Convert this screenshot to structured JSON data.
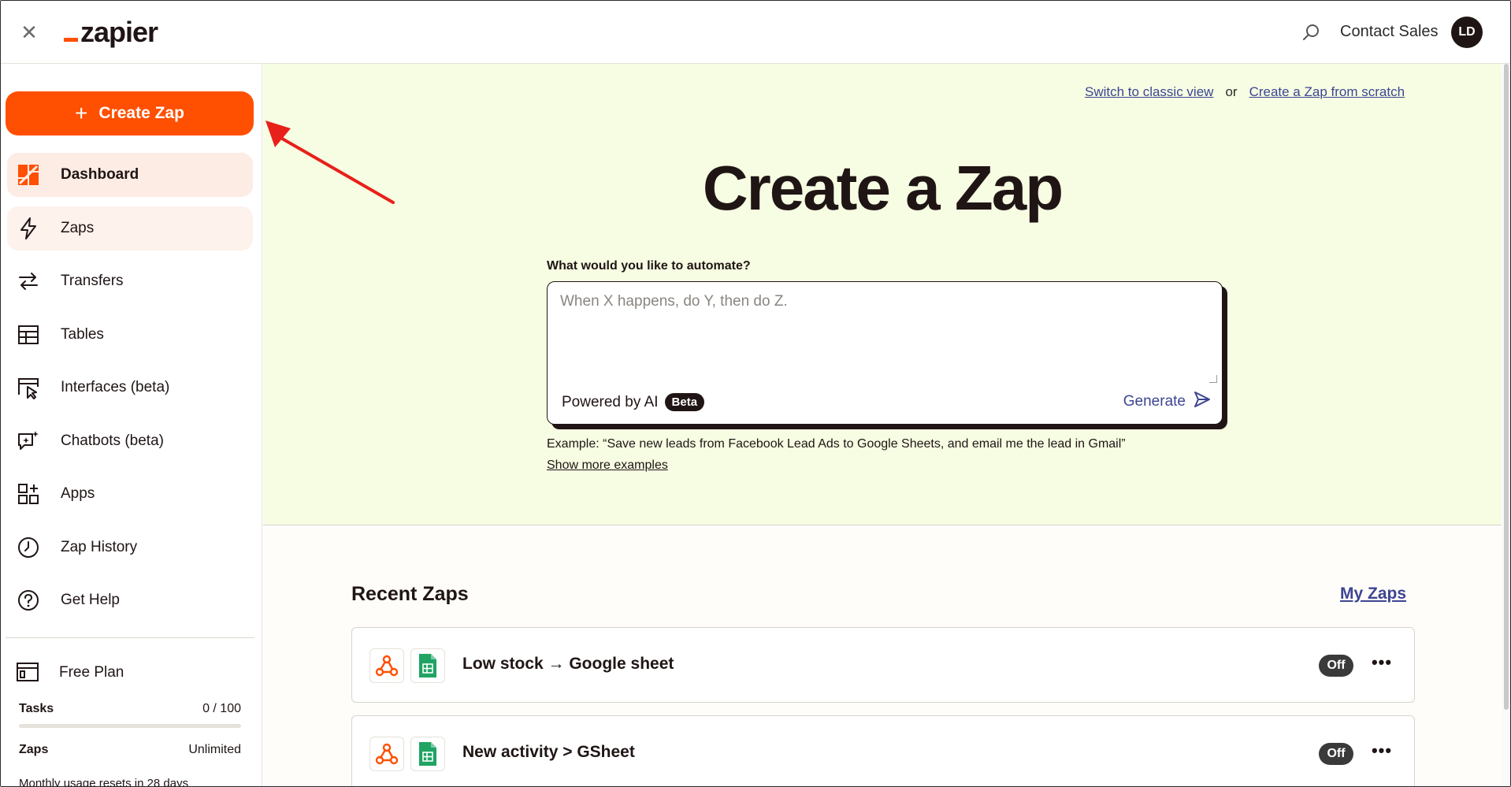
{
  "topbar": {
    "logo_text": "zapier",
    "contact_sales": "Contact Sales",
    "avatar_initials": "LD",
    "close_icon": "close-icon",
    "search_icon": "search-icon"
  },
  "sidebar": {
    "create_zap_label": "Create Zap",
    "items": [
      {
        "label": "Dashboard",
        "icon": "dashboard-icon",
        "state": "active"
      },
      {
        "label": "Zaps",
        "icon": "bolt-icon",
        "state": "hover"
      },
      {
        "label": "Transfers",
        "icon": "transfer-icon",
        "state": "normal"
      },
      {
        "label": "Tables",
        "icon": "table-icon",
        "state": "normal"
      },
      {
        "label": "Interfaces (beta)",
        "icon": "interface-icon",
        "state": "normal"
      },
      {
        "label": "Chatbots (beta)",
        "icon": "chatbot-icon",
        "state": "normal"
      },
      {
        "label": "Apps",
        "icon": "apps-icon",
        "state": "normal"
      },
      {
        "label": "Zap History",
        "icon": "clock-icon",
        "state": "normal"
      },
      {
        "label": "Get Help",
        "icon": "help-icon",
        "state": "normal"
      }
    ],
    "plan": {
      "label": "Free Plan",
      "tasks_label": "Tasks",
      "tasks_value": "0 / 100",
      "tasks_fraction": 0,
      "zaps_label": "Zaps",
      "zaps_value": "Unlimited",
      "reset_text": "Monthly usage resets in 28 days"
    }
  },
  "hero": {
    "switch_classic": "Switch to classic view",
    "or": "or",
    "from_scratch": "Create a Zap from scratch",
    "title": "Create a Zap",
    "prompt_label": "What would you like to automate?",
    "prompt_placeholder": "When X happens, do Y, then do Z.",
    "powered_by": "Powered by AI",
    "beta": "Beta",
    "generate": "Generate",
    "example": "Example: “Save new leads from Facebook Lead Ads to Google Sheets, and email me the lead in Gmail”",
    "show_more": "Show more examples"
  },
  "recent": {
    "title": "Recent Zaps",
    "my_zaps": "My Zaps",
    "zaps": [
      {
        "name": "Low stock → Google sheet",
        "status": "Off",
        "apps": [
          "webhook-icon",
          "google-sheets-icon"
        ]
      },
      {
        "name": "New activity > GSheet",
        "status": "Off",
        "apps": [
          "webhook-icon",
          "google-sheets-icon"
        ]
      }
    ]
  },
  "colors": {
    "brand_orange": "#ff4f00",
    "hero_bg": "#f6fde2",
    "link_blue": "#3d4592",
    "dark": "#201515",
    "annotation_red": "#e8201a"
  }
}
